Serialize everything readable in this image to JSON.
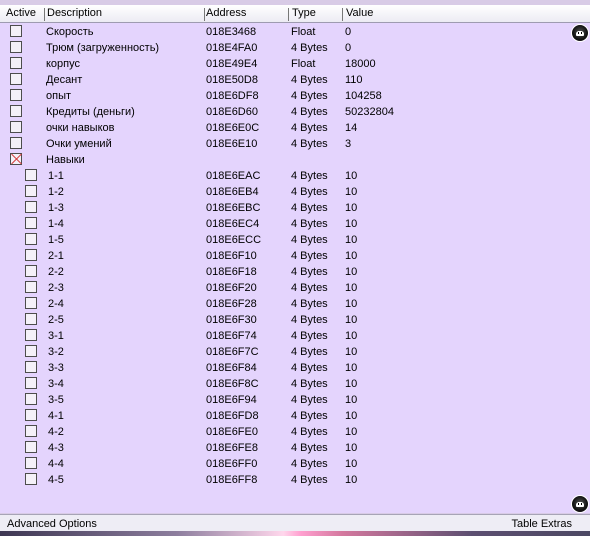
{
  "header": {
    "active": "Active",
    "description": "Description",
    "address": "Address",
    "type": "Type",
    "value": "Value"
  },
  "rows": [
    {
      "description": "Скорость",
      "address": "018E3468",
      "type": "Float",
      "value": "0",
      "checked": false,
      "indent": 0
    },
    {
      "description": "Трюм (загруженность)",
      "address": "018E4FA0",
      "type": "4 Bytes",
      "value": "0",
      "checked": false,
      "indent": 0
    },
    {
      "description": "корпус",
      "address": "018E49E4",
      "type": "Float",
      "value": "18000",
      "checked": false,
      "indent": 0
    },
    {
      "description": "Десант",
      "address": "018E50D8",
      "type": "4 Bytes",
      "value": "110",
      "checked": false,
      "indent": 0
    },
    {
      "description": "опыт",
      "address": "018E6DF8",
      "type": "4 Bytes",
      "value": "104258",
      "checked": false,
      "indent": 0
    },
    {
      "description": "Кредиты (деньги)",
      "address": "018E6D60",
      "type": "4 Bytes",
      "value": "50232804",
      "checked": false,
      "indent": 0
    },
    {
      "description": "очки навыков",
      "address": "018E6E0C",
      "type": "4 Bytes",
      "value": "14",
      "checked": false,
      "indent": 0
    },
    {
      "description": "Очки умений",
      "address": "018E6E10",
      "type": "4 Bytes",
      "value": "3",
      "checked": false,
      "indent": 0
    },
    {
      "description": "Навыки",
      "address": "",
      "type": "",
      "value": "",
      "checked": true,
      "indent": 0
    },
    {
      "description": "1-1",
      "address": "018E6EAC",
      "type": "4 Bytes",
      "value": "10",
      "checked": false,
      "indent": 1
    },
    {
      "description": "1-2",
      "address": "018E6EB4",
      "type": "4 Bytes",
      "value": "10",
      "checked": false,
      "indent": 1
    },
    {
      "description": "1-3",
      "address": "018E6EBC",
      "type": "4 Bytes",
      "value": "10",
      "checked": false,
      "indent": 1
    },
    {
      "description": "1-4",
      "address": "018E6EC4",
      "type": "4 Bytes",
      "value": "10",
      "checked": false,
      "indent": 1
    },
    {
      "description": "1-5",
      "address": "018E6ECC",
      "type": "4 Bytes",
      "value": "10",
      "checked": false,
      "indent": 1
    },
    {
      "description": "2-1",
      "address": "018E6F10",
      "type": "4 Bytes",
      "value": "10",
      "checked": false,
      "indent": 1
    },
    {
      "description": "2-2",
      "address": "018E6F18",
      "type": "4 Bytes",
      "value": "10",
      "checked": false,
      "indent": 1
    },
    {
      "description": "2-3",
      "address": "018E6F20",
      "type": "4 Bytes",
      "value": "10",
      "checked": false,
      "indent": 1
    },
    {
      "description": "2-4",
      "address": "018E6F28",
      "type": "4 Bytes",
      "value": "10",
      "checked": false,
      "indent": 1
    },
    {
      "description": "2-5",
      "address": "018E6F30",
      "type": "4 Bytes",
      "value": "10",
      "checked": false,
      "indent": 1
    },
    {
      "description": "3-1",
      "address": "018E6F74",
      "type": "4 Bytes",
      "value": "10",
      "checked": false,
      "indent": 1
    },
    {
      "description": "3-2",
      "address": "018E6F7C",
      "type": "4 Bytes",
      "value": "10",
      "checked": false,
      "indent": 1
    },
    {
      "description": "3-3",
      "address": "018E6F84",
      "type": "4 Bytes",
      "value": "10",
      "checked": false,
      "indent": 1
    },
    {
      "description": "3-4",
      "address": "018E6F8C",
      "type": "4 Bytes",
      "value": "10",
      "checked": false,
      "indent": 1
    },
    {
      "description": "3-5",
      "address": "018E6F94",
      "type": "4 Bytes",
      "value": "10",
      "checked": false,
      "indent": 1
    },
    {
      "description": "4-1",
      "address": "018E6FD8",
      "type": "4 Bytes",
      "value": "10",
      "checked": false,
      "indent": 1
    },
    {
      "description": "4-2",
      "address": "018E6FE0",
      "type": "4 Bytes",
      "value": "10",
      "checked": false,
      "indent": 1
    },
    {
      "description": "4-3",
      "address": "018E6FE8",
      "type": "4 Bytes",
      "value": "10",
      "checked": false,
      "indent": 1
    },
    {
      "description": "4-4",
      "address": "018E6FF0",
      "type": "4 Bytes",
      "value": "10",
      "checked": false,
      "indent": 1
    },
    {
      "description": "4-5",
      "address": "018E6FF8",
      "type": "4 Bytes",
      "value": "10",
      "checked": false,
      "indent": 1
    }
  ],
  "status": {
    "advanced_options": "Advanced Options",
    "table_extras": "Table Extras"
  },
  "colors": {
    "table_background": "#e4d4fd",
    "check_mark": "#d23232"
  }
}
